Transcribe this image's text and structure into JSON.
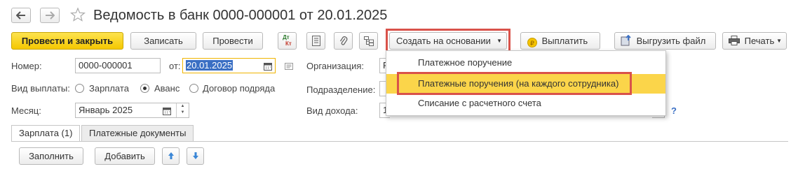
{
  "header": {
    "back_icon": "arrow-left-icon",
    "forward_icon": "arrow-right-icon",
    "favorite_icon": "star-icon",
    "title": "Ведомость в банк 0000-000001 от 20.01.2025"
  },
  "toolbar": {
    "post_close": "Провести и закрыть",
    "save": "Записать",
    "post": "Провести",
    "dt_kt_top": "Дт",
    "dt_kt_bottom": "Кт",
    "create_based": "Создать на основании",
    "pay": "Выплатить",
    "export": "Выгрузить файл",
    "print": "Печать"
  },
  "form": {
    "number_label": "Номер:",
    "number_value": "0000-000001",
    "from_label": "от:",
    "date_value": "20.01.2025",
    "org_label": "Организация:",
    "org_value_partial": "Р",
    "payout_label": "Вид выплаты:",
    "radio_salary": "Зарплата",
    "radio_advance": "Аванс",
    "radio_contract": "Договор подряда",
    "subdivision_label": "Подразделение:",
    "month_label": "Месяц:",
    "month_value": "Январь 2025",
    "income_label": "Вид дохода:",
    "income_value_partial": "1",
    "help_mark": "?"
  },
  "dropdown": {
    "items": [
      "Платежное поручение",
      "Платежные поручения (на каждого сотрудника)",
      "Списание с расчетного счета"
    ]
  },
  "tabs": {
    "salary": "Зарплата (1)",
    "payment_docs": "Платежные документы"
  },
  "table_toolbar": {
    "fill": "Заполнить",
    "add": "Добавить"
  },
  "colors": {
    "primary_button": "#f5c800",
    "menu_highlight": "#fbd54a",
    "annotation_red": "#d9524a",
    "date_selection": "#3a6fc4"
  }
}
